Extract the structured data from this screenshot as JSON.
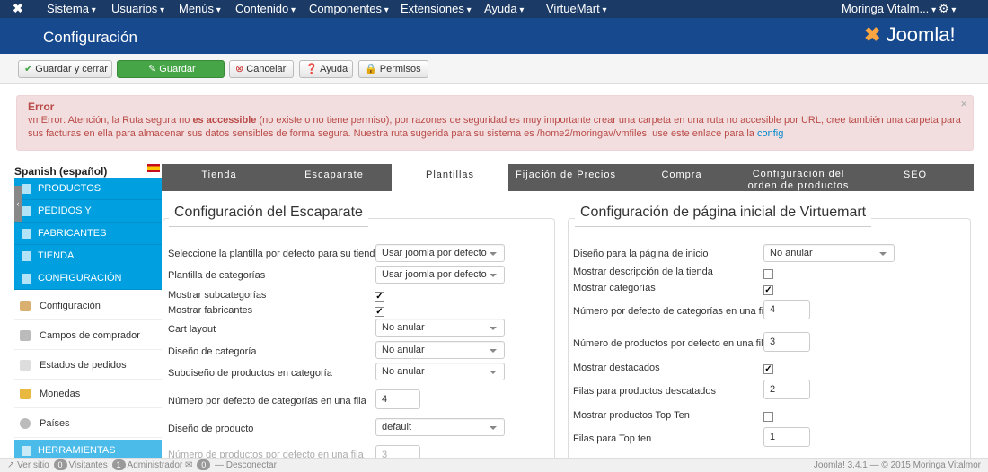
{
  "topnav": {
    "menus": [
      "Sistema",
      "Usuarios",
      "Menús",
      "Contenido",
      "Componentes",
      "Extensiones",
      "Ayuda",
      "VirtueMart"
    ],
    "user": "Moringa Vitalm...",
    "gear": "⚙"
  },
  "header": {
    "title": "Configuración",
    "logo": "Joomla!"
  },
  "toolbar": {
    "save_close": "Guardar y cerrar",
    "save": "Guardar",
    "cancel": "Cancelar",
    "help": "Ayuda",
    "perms": "Permisos"
  },
  "error": {
    "title": "Error",
    "text": "vmError: Atención, la Ruta segura no ",
    "bold": "es accessible",
    "text2": " (no existe o no tiene permiso), por razones de seguridad es muy importante crear una carpeta en una ruta no accesible por URL, cree también una carpeta para sus facturas en ella para almacenar sus datos sensibles de forma segura. Nuestra ruta sugerida para su sistema es /home2/moringav/vmfiles, use este enlace para la ",
    "link": "config",
    "close": "×"
  },
  "sidebar": {
    "lang": "Spanish (español)",
    "blue": [
      "PRODUCTOS",
      "PEDIDOS Y",
      "FABRICANTES",
      "TIENDA",
      "CONFIGURACIÓN"
    ],
    "items": [
      "Configuración",
      "Campos de comprador",
      "Estados de pedidos",
      "Monedas",
      "Países"
    ],
    "tools": "HERRAMIENTAS"
  },
  "tabs": [
    "Tienda",
    "Escaparate",
    "Plantillas",
    "Fijación de Precios",
    "Compra",
    "Configuración del orden de productos",
    "SEO"
  ],
  "left": {
    "legend": "Configuración del Escaparate",
    "l1": "Seleccione la plantilla por defecto para su tienda",
    "v1": "Usar joomla por defecto",
    "l2": "Plantilla de categorías",
    "v2": "Usar joomla por defecto",
    "l3": "Mostrar subcategorías",
    "l4": "Mostrar fabricantes",
    "l5": "Cart layout",
    "v5": "No anular",
    "l6": "Diseño de categoría",
    "v6": "No anular",
    "l7": "Subdiseño de productos en categoría",
    "v7": "No anular",
    "l8": "Número por defecto de categorías en una fila",
    "v8": "4",
    "l9": "Diseño de producto",
    "v9": "default",
    "l10": "Número de productos por defecto en una fila",
    "v10": "3"
  },
  "right": {
    "legend": "Configuración de página inicial de Virtuemart",
    "l1": "Diseño para la página de inicio",
    "v1": "No anular",
    "l2": "Mostrar descripción de la tienda",
    "l3": "Mostrar categorías",
    "l4": "Número por defecto de categorías en una fila",
    "v4": "4",
    "l5": "Número de productos por defecto en una fila",
    "v5": "3",
    "l6": "Mostrar destacados",
    "l7": "Filas para productos descatados",
    "v7": "2",
    "l8": "Mostrar productos Top Ten",
    "l9": "Filas para Top ten",
    "v9": "1"
  },
  "footer": {
    "site": "Ver sitio",
    "visitors_n": "0",
    "visitors": "Visitantes",
    "admin_n": "1",
    "admin": "Administrador",
    "msg_n": "0",
    "logout": "Desconectar",
    "copy": "Joomla! 3.4.1 — © 2015 Moringa Vitalmor"
  },
  "check": "✓"
}
